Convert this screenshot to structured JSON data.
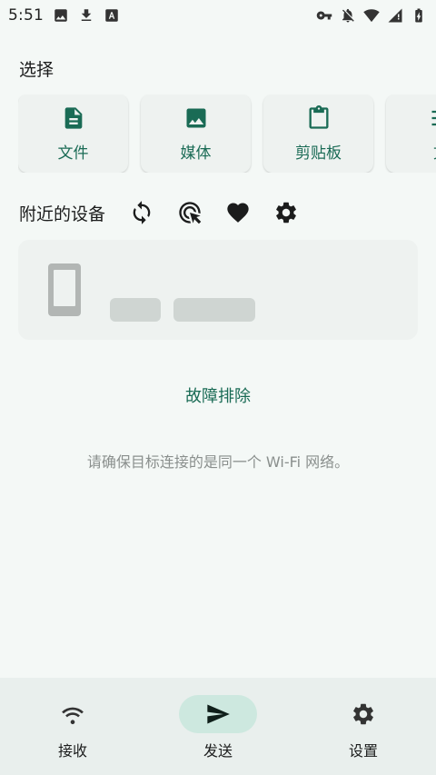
{
  "status_bar": {
    "time": "5:51",
    "left_icons": [
      "image-icon",
      "download-icon",
      "font-app-icon"
    ],
    "right_icons": [
      "vpn-key-icon",
      "notifications-off-icon",
      "wifi-icon",
      "cellular-icon",
      "battery-icon"
    ]
  },
  "select": {
    "title": "选择",
    "items": [
      {
        "label": "文件",
        "icon": "file-icon"
      },
      {
        "label": "媒体",
        "icon": "image-icon"
      },
      {
        "label": "剪贴板",
        "icon": "clipboard-icon"
      },
      {
        "label": "文",
        "icon": "text-icon"
      }
    ]
  },
  "nearby": {
    "title": "附近的设备",
    "actions": [
      "refresh-icon",
      "target-cursor-icon",
      "favorite-icon",
      "settings-icon"
    ]
  },
  "troubleshoot": {
    "label": "故障排除"
  },
  "hint": {
    "text": "请确保目标连接的是同一个 Wi-Fi 网络。"
  },
  "bottom_nav": {
    "items": [
      {
        "label": "接收",
        "icon": "wifi-receive-icon",
        "active": false
      },
      {
        "label": "发送",
        "icon": "send-icon",
        "active": true
      },
      {
        "label": "设置",
        "icon": "settings-icon",
        "active": false
      }
    ]
  },
  "colors": {
    "accent": "#1a6b55",
    "background": "#f4f8f6",
    "card": "#eef2f0",
    "nav_active": "#cde8df"
  }
}
